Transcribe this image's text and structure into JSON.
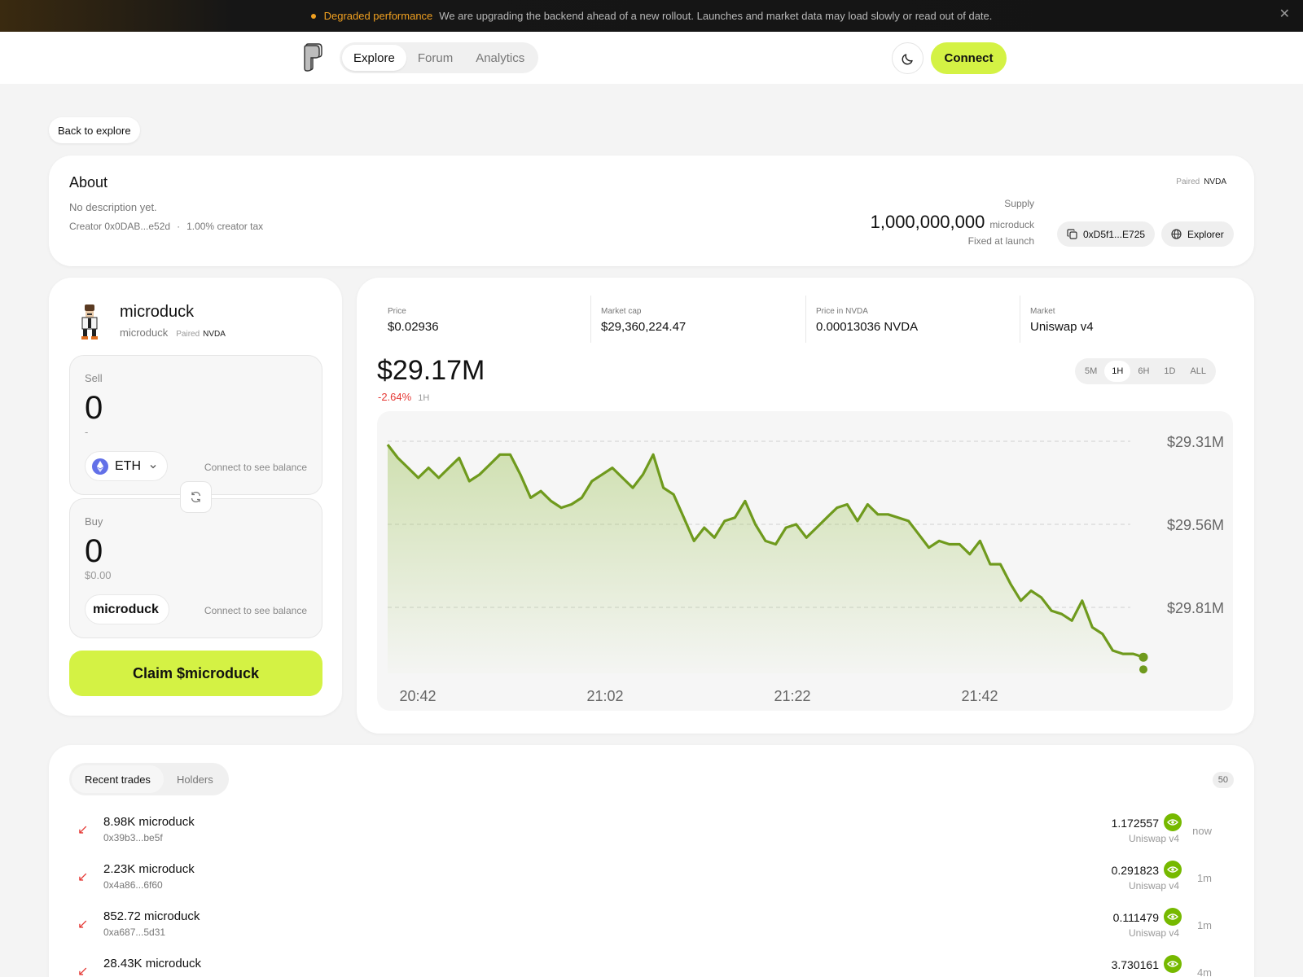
{
  "banner": {
    "title": "Degraded performance",
    "message": "We are upgrading the backend ahead of a new rollout. Launches and market data may load slowly or read out of date.",
    "close_icon": "close-icon"
  },
  "nav": {
    "tabs": [
      "Explore",
      "Forum",
      "Analytics"
    ],
    "active_tab": "Explore",
    "theme_icon": "moon-icon",
    "connect_label": "Connect"
  },
  "back_label": "Back to explore",
  "about": {
    "title": "About",
    "description": "No description yet.",
    "creator": "Creator 0x0DAB...e52d",
    "separator": "·",
    "tax": "1.00% creator tax",
    "paired_label": "Paired",
    "paired_value": "NVDA",
    "supply_label": "Supply",
    "supply_value": "1,000,000,000",
    "supply_unit": "microduck",
    "supply_note": "Fixed at launch",
    "address_label": "0xD5f1...E725",
    "explorer_label": "Explorer"
  },
  "swap": {
    "token_name": "microduck",
    "token_symbol": "microduck",
    "paired_label": "Paired",
    "paired_value": "NVDA",
    "sell": {
      "label": "Sell",
      "amount": "0",
      "sub": "-",
      "token": "ETH",
      "balance": "Connect to see balance"
    },
    "buy": {
      "label": "Buy",
      "amount": "0",
      "sub": "$0.00",
      "token": "microduck",
      "balance": "Connect to see balance"
    },
    "claim_label": "Claim $microduck"
  },
  "stats": [
    {
      "label": "Price",
      "value": "$0.02936"
    },
    {
      "label": "Market cap",
      "value": "$29,360,224.47"
    },
    {
      "label": "Price in NVDA",
      "value": "0.00013036 NVDA"
    },
    {
      "label": "Market",
      "value": "Uniswap v4"
    }
  ],
  "headline": {
    "value": "$29.17M",
    "change": "-2.64%",
    "period": "1H"
  },
  "ranges": [
    "5M",
    "1H",
    "6H",
    "1D",
    "ALL"
  ],
  "active_range": "1H",
  "chart_data": {
    "type": "area",
    "y_tick_labels": [
      "$29.31M",
      "$29.56M",
      "$29.81M"
    ],
    "x_tick_labels": [
      "20:42",
      "21:02",
      "21:22",
      "21:42"
    ],
    "grid": "horizontal dashed",
    "line_color": "#6f9a1d",
    "values": [
      29.4,
      29.36,
      29.33,
      29.3,
      29.33,
      29.3,
      29.33,
      29.36,
      29.29,
      29.31,
      29.34,
      29.37,
      29.37,
      29.31,
      29.24,
      29.26,
      29.23,
      29.21,
      29.22,
      29.24,
      29.29,
      29.31,
      29.33,
      29.3,
      29.27,
      29.31,
      29.37,
      29.27,
      29.25,
      29.18,
      29.11,
      29.15,
      29.12,
      29.17,
      29.18,
      29.23,
      29.16,
      29.11,
      29.1,
      29.15,
      29.16,
      29.12,
      29.15,
      29.18,
      29.21,
      29.22,
      29.17,
      29.22,
      29.19,
      29.19,
      29.18,
      29.17,
      29.13,
      29.09,
      29.11,
      29.1,
      29.1,
      29.07,
      29.11,
      29.04,
      29.04,
      28.98,
      28.93,
      28.96,
      28.94,
      28.9,
      28.89,
      28.87,
      28.93,
      28.85,
      28.83,
      28.78,
      28.77,
      28.77,
      28.76
    ]
  },
  "trades": {
    "tabs": [
      "Recent trades",
      "Holders"
    ],
    "active_tab": "Recent trades",
    "count": "50",
    "rows": [
      {
        "amount": "8.98K microduck",
        "address": "0x39b3...be5f",
        "value": "1.172557",
        "pool": "Uniswap v4",
        "time": "now"
      },
      {
        "amount": "2.23K microduck",
        "address": "0x4a86...6f60",
        "value": "0.291823",
        "pool": "Uniswap v4",
        "time": "1m"
      },
      {
        "amount": "852.72 microduck",
        "address": "0xa687...5d31",
        "value": "0.111479",
        "pool": "Uniswap v4",
        "time": "1m"
      },
      {
        "amount": "28.43K microduck",
        "address": "",
        "value": "3.730161",
        "pool": "",
        "time": "4m"
      }
    ]
  }
}
